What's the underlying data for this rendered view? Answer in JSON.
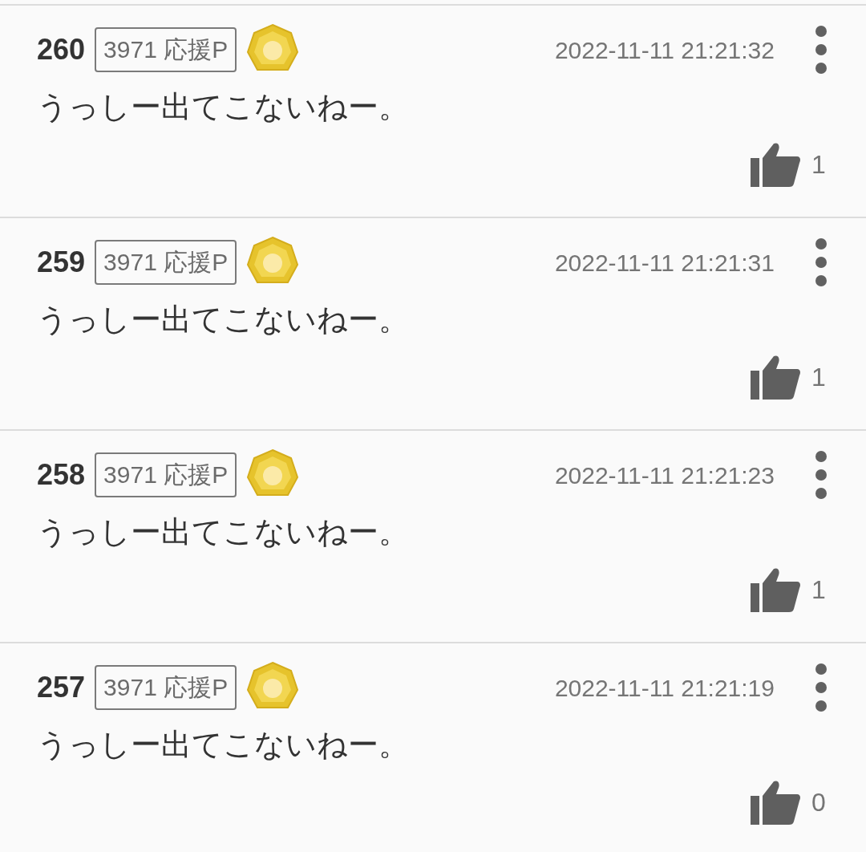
{
  "comments": [
    {
      "number": "260",
      "points": "3971 応援P",
      "date": "2022-11-11 21:21:32",
      "text": "うっしー出てこないねー。",
      "likes": "1"
    },
    {
      "number": "259",
      "points": "3971 応援P",
      "date": "2022-11-11 21:21:31",
      "text": "うっしー出てこないねー。",
      "likes": "1"
    },
    {
      "number": "258",
      "points": "3971 応援P",
      "date": "2022-11-11 21:21:23",
      "text": "うっしー出てこないねー。",
      "likes": "1"
    },
    {
      "number": "257",
      "points": "3971 応援P",
      "date": "2022-11-11 21:21:19",
      "text": "うっしー出てこないねー。",
      "likes": "0"
    }
  ]
}
